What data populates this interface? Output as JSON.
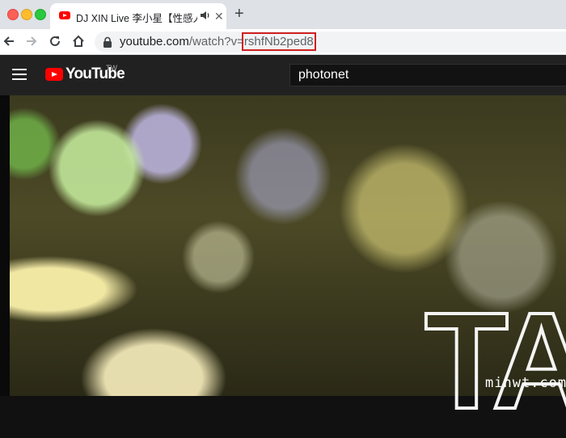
{
  "browser": {
    "tab": {
      "title": "DJ XIN Live 李小星【性感人",
      "favicon_icon": "youtube-favicon-icon",
      "audio_icon": "speaker-icon",
      "close_label": "✕"
    },
    "new_tab_label": "+",
    "omnibox": {
      "host": "youtube.com",
      "path": "/watch?v=",
      "video_id": "rshfNb2ped8"
    }
  },
  "youtube": {
    "logo_text": "YouTube",
    "region": "TW",
    "search_value": "photonet"
  },
  "video": {
    "overlay_text": "TA"
  },
  "watermark": "minwt.com",
  "colors": {
    "youtube_red": "#ff0000",
    "header_bg": "#212121",
    "highlight_box": "#d01f1f"
  }
}
